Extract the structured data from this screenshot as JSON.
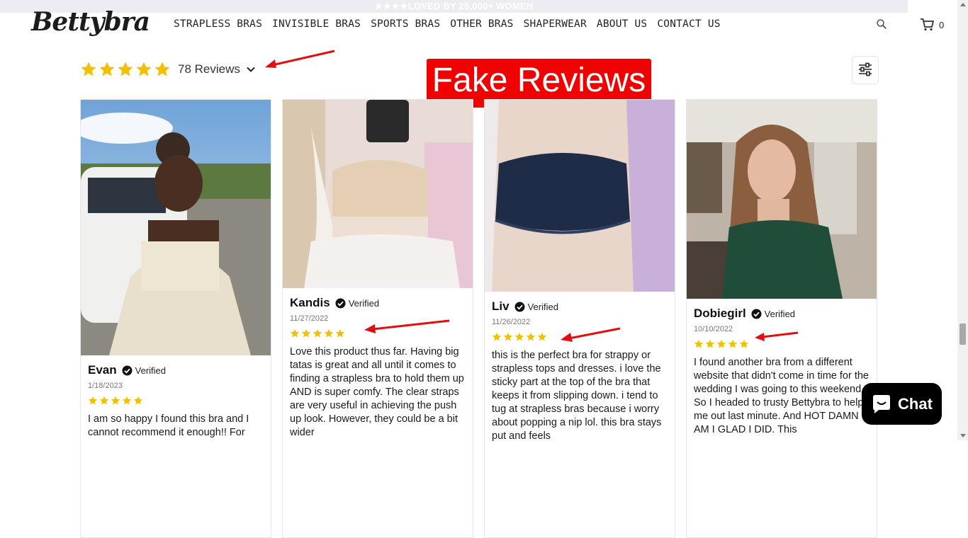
{
  "announcement": "★★★★LOVED BY 25,000+ WOMEN",
  "brand": "Bettybra",
  "nav": [
    "STRAPLESS BRAS",
    "INVISIBLE BRAS",
    "SPORTS BRAS",
    "OTHER BRAS",
    "SHAPERWEAR",
    "ABOUT US",
    "CONTACT US"
  ],
  "cart_count": "0",
  "summary": {
    "review_count_label": "78 Reviews",
    "rating": 5
  },
  "overlay_label": "Fake Reviews",
  "verified_label": "Verified",
  "reviews": [
    {
      "name": "Evan",
      "date": "1/18/2023",
      "rating": 5,
      "text": "I am so happy I found this bra and I cannot recommend it enough!! For"
    },
    {
      "name": "Kandis",
      "date": "11/27/2022",
      "rating": 5,
      "text": "Love this product thus far. Having big tatas is great and all until it comes to finding a strapless bra to hold them up AND is super comfy. The clear straps are very useful in achieving the push up look. However, they could be a bit wider"
    },
    {
      "name": "Liv",
      "date": "11/26/2022",
      "rating": 5,
      "text": "this is the perfect bra for strappy or strapless tops and dresses. i love the sticky part at the top of the bra that keeps it from slipping down. i tend to tug at strapless bras because i worry about popping a nip lol. this bra stays put and feels"
    },
    {
      "name": "Dobiegirl",
      "date": "10/10/2022",
      "rating": 5,
      "text": "I found another bra from a different website that didn't come in time for the wedding I was going to this weekend. So I headed to trusty Bettybra to help me out last minute. And HOT DAMN AM I GLAD I DID. This"
    }
  ],
  "chat": {
    "label": "Chat"
  },
  "colors": {
    "star": "#f2c000",
    "banner": "#f20000",
    "arrow": "#e01010",
    "chat_bg": "#000000"
  }
}
